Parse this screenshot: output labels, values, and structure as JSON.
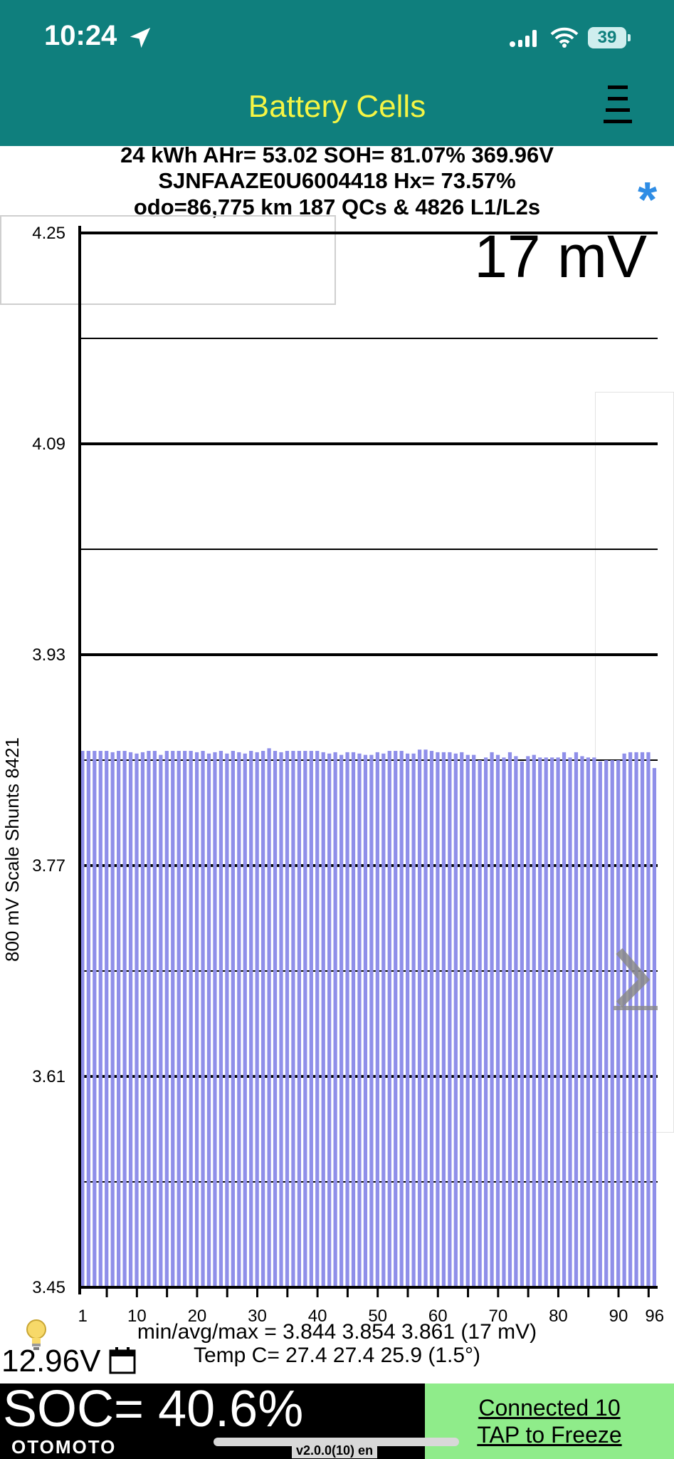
{
  "status_bar": {
    "time": "10:24",
    "battery_level": "39"
  },
  "header": {
    "title": "Battery Cells"
  },
  "info": {
    "line1": "24 kWh  AHr= 53.02  SOH= 81.07%   369.96V",
    "line2": "SJNFAAZE0U6004418   Hx= 73.57%",
    "line3": "odo=86,775 km 187 QCs & 4826 L1/L2s"
  },
  "spread_label": "17 mV",
  "chart_data": {
    "type": "bar",
    "ylabel": "800 mV Scale   Shunts 8421",
    "ylim": [
      3.45,
      4.25
    ],
    "y_ticks": [
      "4.25",
      "4.09",
      "3.93",
      "3.77",
      "3.61",
      "3.45"
    ],
    "x_ticks": [
      "1",
      "10",
      "20",
      "30",
      "40",
      "50",
      "60",
      "70",
      "80",
      "90",
      "96"
    ],
    "cell_count": 96,
    "values": [
      3.857,
      3.857,
      3.857,
      3.857,
      3.857,
      3.856,
      3.857,
      3.857,
      3.856,
      3.855,
      3.856,
      3.857,
      3.857,
      3.854,
      3.857,
      3.857,
      3.857,
      3.857,
      3.857,
      3.856,
      3.857,
      3.855,
      3.856,
      3.857,
      3.855,
      3.857,
      3.856,
      3.855,
      3.857,
      3.856,
      3.857,
      3.859,
      3.857,
      3.856,
      3.857,
      3.857,
      3.857,
      3.857,
      3.857,
      3.857,
      3.856,
      3.855,
      3.856,
      3.854,
      3.856,
      3.856,
      3.855,
      3.854,
      3.854,
      3.856,
      3.855,
      3.857,
      3.857,
      3.857,
      3.855,
      3.855,
      3.858,
      3.858,
      3.857,
      3.856,
      3.856,
      3.856,
      3.855,
      3.856,
      3.854,
      3.854,
      3.85,
      3.852,
      3.856,
      3.854,
      3.852,
      3.856,
      3.853,
      3.849,
      3.853,
      3.854,
      3.852,
      3.852,
      3.852,
      3.852,
      3.856,
      3.852,
      3.856,
      3.853,
      3.852,
      3.852,
      3.849,
      3.85,
      3.85,
      3.85,
      3.855,
      3.856,
      3.856,
      3.856,
      3.856,
      3.844
    ]
  },
  "stats": {
    "line1": "min/avg/max = 3.844 3.854 3.861  (17 mV)",
    "line2": "Temp C= 27.4  27.4  25.9  (1.5°)"
  },
  "aux_voltage": "12.96V",
  "soc": "SOC= 40.6%",
  "brand": "OTOMOTO",
  "connection": {
    "connected_text": "Connected 10",
    "freeze_text": "TAP to Freeze"
  },
  "version": "v2.0.0(10) en",
  "colors": {
    "header_bg": "#0f7f7d",
    "title": "#f5f544",
    "bar": "#8f8fe9",
    "connect_panel": "#8fec8a",
    "star": "#2f8de5"
  }
}
